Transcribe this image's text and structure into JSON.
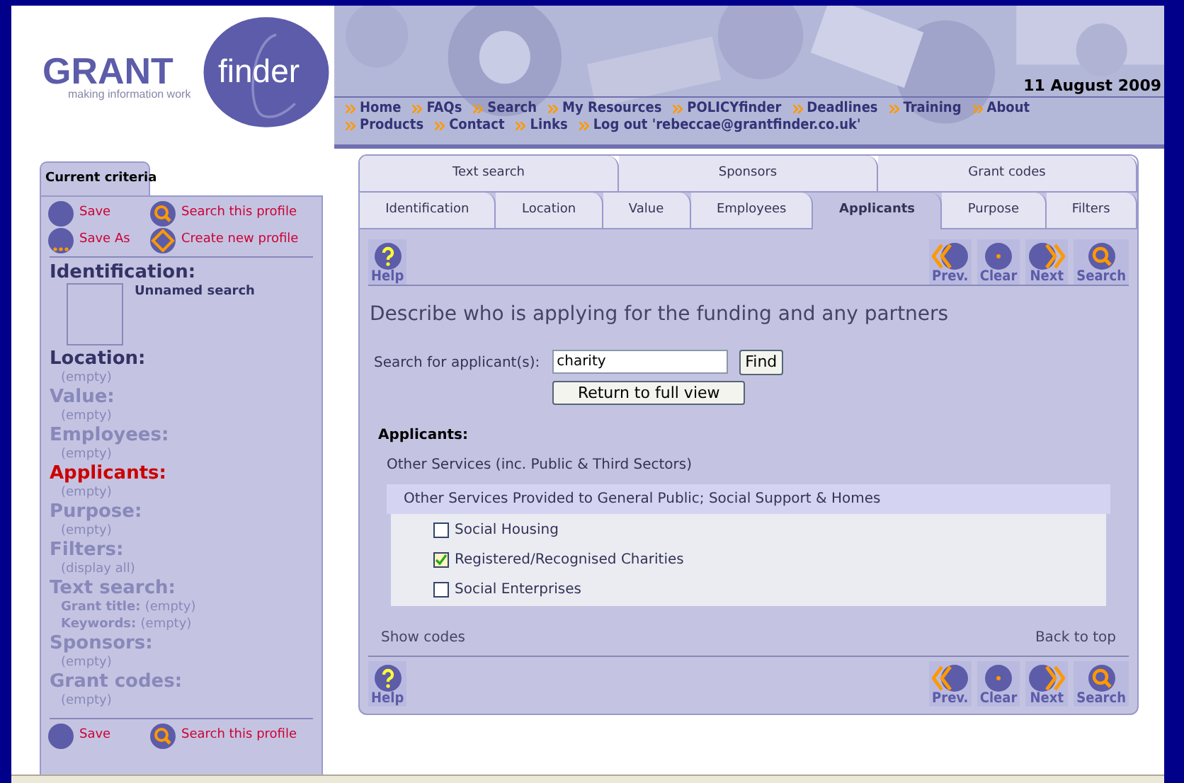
{
  "header": {
    "logo_word": "GRANT",
    "logo_script": "finder",
    "tagline": "making information work",
    "date": "11 August 2009",
    "nav": [
      [
        "Home",
        "FAQs",
        "Search",
        "My Resources",
        "POLICYfinder",
        "Deadlines",
        "Training",
        "About"
      ],
      [
        "Products",
        "Contact",
        "Links",
        "Log out 'rebeccae@grantfinder.co.uk'"
      ]
    ]
  },
  "sidebar": {
    "tab": "Current criteria",
    "actions": [
      {
        "label": "Save",
        "kind": "save"
      },
      {
        "label": "Search this profile",
        "kind": "search"
      },
      {
        "label": "Save As",
        "kind": "saveas"
      },
      {
        "label": "Create new profile",
        "kind": "new"
      }
    ],
    "sections": [
      {
        "label": "Identification:",
        "kind": "filled",
        "thumbnail": true,
        "values": [
          {
            "text": "Unnamed search"
          }
        ]
      },
      {
        "label": "Location:",
        "kind": "filled",
        "values": [
          {
            "text": "(empty)"
          }
        ]
      },
      {
        "label": "Value:",
        "kind": "dim",
        "values": [
          {
            "text": "(empty)"
          }
        ]
      },
      {
        "label": "Employees:",
        "kind": "dim",
        "values": [
          {
            "text": "(empty)"
          }
        ]
      },
      {
        "label": "Applicants:",
        "kind": "current",
        "values": [
          {
            "text": "(empty)"
          }
        ]
      },
      {
        "label": "Purpose:",
        "kind": "dim",
        "values": [
          {
            "text": "(empty)"
          }
        ]
      },
      {
        "label": "Filters:",
        "kind": "dim",
        "values": [
          {
            "text": "(display all)"
          }
        ]
      },
      {
        "label": "Text search:",
        "kind": "dim",
        "values": [
          {
            "key": "Grant title:",
            "text": "(empty)"
          },
          {
            "key": "Keywords:",
            "text": "(empty)"
          }
        ]
      },
      {
        "label": "Sponsors:",
        "kind": "dim",
        "values": [
          {
            "text": "(empty)"
          }
        ]
      },
      {
        "label": "Grant codes:",
        "kind": "dim",
        "values": [
          {
            "text": "(empty)"
          }
        ]
      }
    ],
    "bottom_actions": [
      {
        "label": "Save",
        "kind": "save"
      },
      {
        "label": "Search this profile",
        "kind": "search"
      }
    ]
  },
  "tabs_top": [
    {
      "label": "Text search",
      "selected": false
    },
    {
      "label": "Sponsors",
      "selected": false
    },
    {
      "label": "Grant codes",
      "selected": false
    }
  ],
  "tabs": [
    {
      "label": "Identification",
      "selected": false
    },
    {
      "label": "Location",
      "selected": false
    },
    {
      "label": "Value",
      "selected": false
    },
    {
      "label": "Employees",
      "selected": false
    },
    {
      "label": "Applicants",
      "selected": true
    },
    {
      "label": "Purpose",
      "selected": false
    },
    {
      "label": "Filters",
      "selected": false
    }
  ],
  "toolbar_bottom": {
    "left": [
      {
        "label": "Help",
        "kind": "help"
      }
    ],
    "right": [
      {
        "label": "Prev.",
        "kind": "prev"
      },
      {
        "label": "Clear",
        "kind": "clear"
      },
      {
        "label": "Next",
        "kind": "next"
      },
      {
        "label": "Search",
        "kind": "search"
      }
    ]
  },
  "toolbar": {
    "left": [
      {
        "label": "Help",
        "kind": "help"
      }
    ],
    "right": [
      {
        "label": "Prev.",
        "kind": "prev"
      },
      {
        "label": "Clear",
        "kind": "clear"
      },
      {
        "label": "Next",
        "kind": "next"
      },
      {
        "label": "Search",
        "kind": "search"
      }
    ]
  },
  "heading": "Describe who is applying for the funding and any partners",
  "search": {
    "label": "Search for applicant(s):",
    "value": "charity",
    "find": "Find",
    "return": "Return to full view"
  },
  "applicants": {
    "title": "Applicants:",
    "category": "Other Services (inc. Public & Third Sectors)",
    "subcategory": "Other Services Provided to General Public; Social Support & Homes",
    "items": [
      {
        "label": "Social Housing",
        "checked": false
      },
      {
        "label": "Registered/Recognised Charities",
        "checked": true
      },
      {
        "label": "Social Enterprises",
        "checked": false
      }
    ]
  },
  "footer_links": [
    "Show codes",
    "Back to top"
  ]
}
